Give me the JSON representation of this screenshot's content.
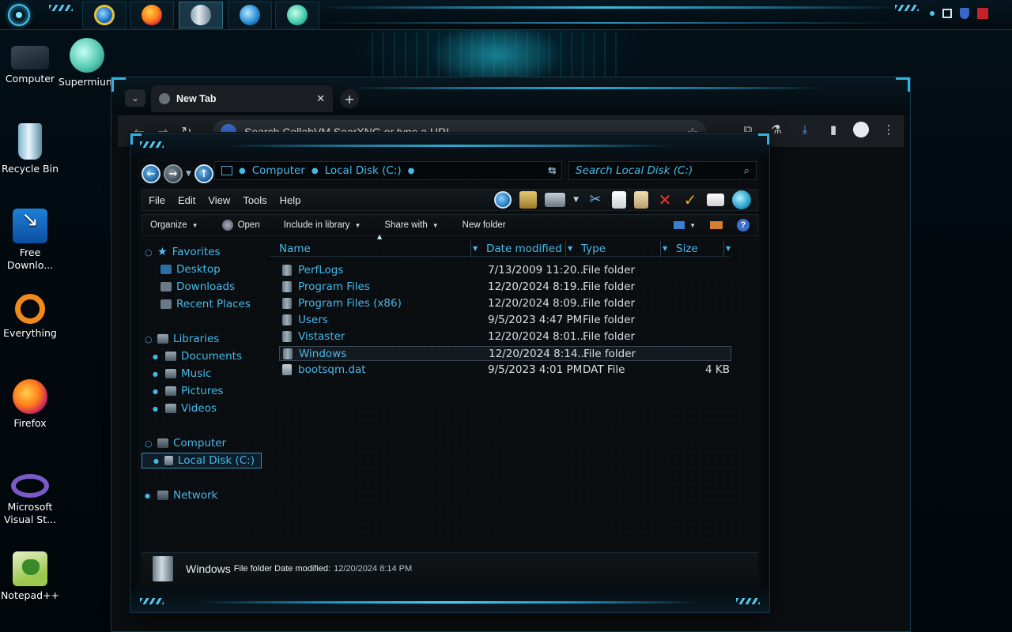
{
  "colors": {
    "accent": "#46b8e8",
    "background": "#02080d",
    "window": "#0a0d10"
  },
  "desktop": {
    "icons": [
      {
        "label": "Computer",
        "icon": "computer-icon"
      },
      {
        "label": "Supermium",
        "icon": "supermium-icon"
      },
      {
        "label": "Recycle Bin",
        "icon": "recycle-bin-icon"
      },
      {
        "label": "Free Downlo...",
        "icon": "free-download-manager-icon"
      },
      {
        "label": "Everything",
        "icon": "everything-search-icon"
      },
      {
        "label": "Firefox",
        "icon": "firefox-icon"
      },
      {
        "label": "Microsoft Visual St...",
        "icon": "visual-studio-icon"
      },
      {
        "label": "Notepad++",
        "icon": "notepad-plus-plus-icon"
      }
    ]
  },
  "taskbar": {
    "apps": [
      "internet-explorer-icon",
      "firefox-icon",
      "explorer-icon",
      "media-player-icon",
      "supermium-icon"
    ]
  },
  "browser": {
    "tab_title": "New Tab",
    "tab_close": "✕",
    "new_tab": "+",
    "omnibox_placeholder": "Search CollabVM SearXNG or type a URL"
  },
  "explorer": {
    "address": {
      "crumbs": [
        "Computer",
        "Local Disk (C:)"
      ]
    },
    "search_placeholder": "Search Local Disk (C:)",
    "menu": [
      "File",
      "Edit",
      "View",
      "Tools",
      "Help"
    ],
    "commands": {
      "organize": "Organize",
      "open": "Open",
      "include": "Include in library",
      "share": "Share with",
      "new_folder": "New folder"
    },
    "nav": {
      "favorites": "Favorites",
      "desktop": "Desktop",
      "downloads": "Downloads",
      "recent": "Recent Places",
      "libraries": "Libraries",
      "documents": "Documents",
      "music": "Music",
      "pictures": "Pictures",
      "videos": "Videos",
      "computer": "Computer",
      "local_disk": "Local Disk (C:)",
      "network": "Network"
    },
    "columns": {
      "name": "Name",
      "date": "Date modified",
      "type": "Type",
      "size": "Size"
    },
    "files": [
      {
        "name": "PerfLogs",
        "date": "7/13/2009 11:20...",
        "type": "File folder",
        "size": ""
      },
      {
        "name": "Program Files",
        "date": "12/20/2024 8:19...",
        "type": "File folder",
        "size": ""
      },
      {
        "name": "Program Files (x86)",
        "date": "12/20/2024 8:09...",
        "type": "File folder",
        "size": ""
      },
      {
        "name": "Users",
        "date": "9/5/2023 4:47 PM",
        "type": "File folder",
        "size": ""
      },
      {
        "name": "Vistaster",
        "date": "12/20/2024 8:01...",
        "type": "File folder",
        "size": ""
      },
      {
        "name": "Windows",
        "date": "12/20/2024 8:14...",
        "type": "File folder",
        "size": ""
      },
      {
        "name": "bootsqm.dat",
        "date": "9/5/2023 4:01 PM",
        "type": "DAT File",
        "size": "4 KB"
      }
    ],
    "details": {
      "name": "Windows",
      "meta": "File folder Date modified:",
      "value": "12/20/2024 8:14 PM"
    }
  }
}
